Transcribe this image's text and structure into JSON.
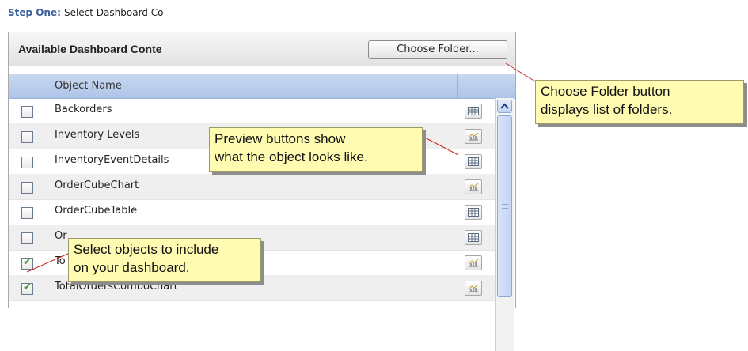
{
  "step": {
    "label": "Step One:",
    "text": "Select Dashboard Co"
  },
  "panel": {
    "title": "Available Dashboard Conte",
    "choose_folder_label": "Choose Folder..."
  },
  "table": {
    "column_header": "Object Name",
    "rows": [
      {
        "name": "Backorders",
        "checked": false,
        "preview_icon": "table-icon"
      },
      {
        "name": "Inventory Levels",
        "checked": false,
        "preview_icon": "chart-icon"
      },
      {
        "name": "InventoryEventDetails",
        "checked": false,
        "preview_icon": "table-icon"
      },
      {
        "name": "OrderCubeChart",
        "checked": false,
        "preview_icon": "chart-icon"
      },
      {
        "name": "OrderCubeTable",
        "checked": false,
        "preview_icon": "table-icon"
      },
      {
        "name": "Or",
        "checked": false,
        "preview_icon": "table-icon"
      },
      {
        "name": "To",
        "checked": true,
        "preview_icon": "chart-icon"
      },
      {
        "name": "TotalOrdersComboChart",
        "checked": true,
        "preview_icon": "chart-icon"
      }
    ]
  },
  "callouts": {
    "folder": [
      "Choose Folder button",
      "displays list of folders."
    ],
    "preview": [
      "Preview buttons show",
      "what the object looks like."
    ],
    "select": [
      "Select objects to include",
      "on your dashboard."
    ]
  },
  "colors": {
    "callout_bg": "#fffbb0",
    "leader_line": "#cc2222",
    "header_bg": "#c9d8f0",
    "step_label": "#3a5f9a"
  }
}
